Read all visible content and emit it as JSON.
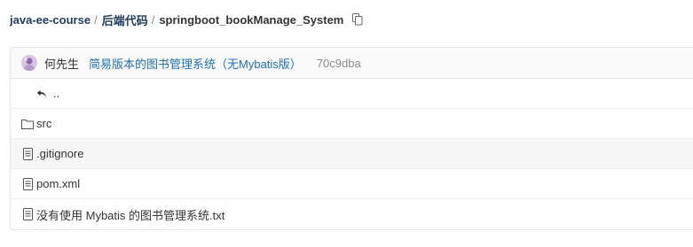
{
  "breadcrumb": {
    "owner": "java-ee-course",
    "separator": "/",
    "folder": "后端代码",
    "repo": "springboot_bookManage_System"
  },
  "commit": {
    "author": "何先生",
    "message": "简易版本的图书管理系统（无Mybatis版）",
    "sha": "70c9dba"
  },
  "tree": {
    "up_label": "..",
    "items": [
      {
        "name": "src",
        "icon": "folder-icon"
      },
      {
        "name": ".gitignore",
        "icon": "file-icon"
      },
      {
        "name": "pom.xml",
        "icon": "file-icon"
      },
      {
        "name": "没有使用 Mybatis 的图书管理系统.txt",
        "icon": "file-icon"
      }
    ]
  },
  "colors": {
    "link": "#1f6fb2",
    "breadcrumb_link": "#1e3a5f",
    "sha": "#8a8a8a"
  }
}
